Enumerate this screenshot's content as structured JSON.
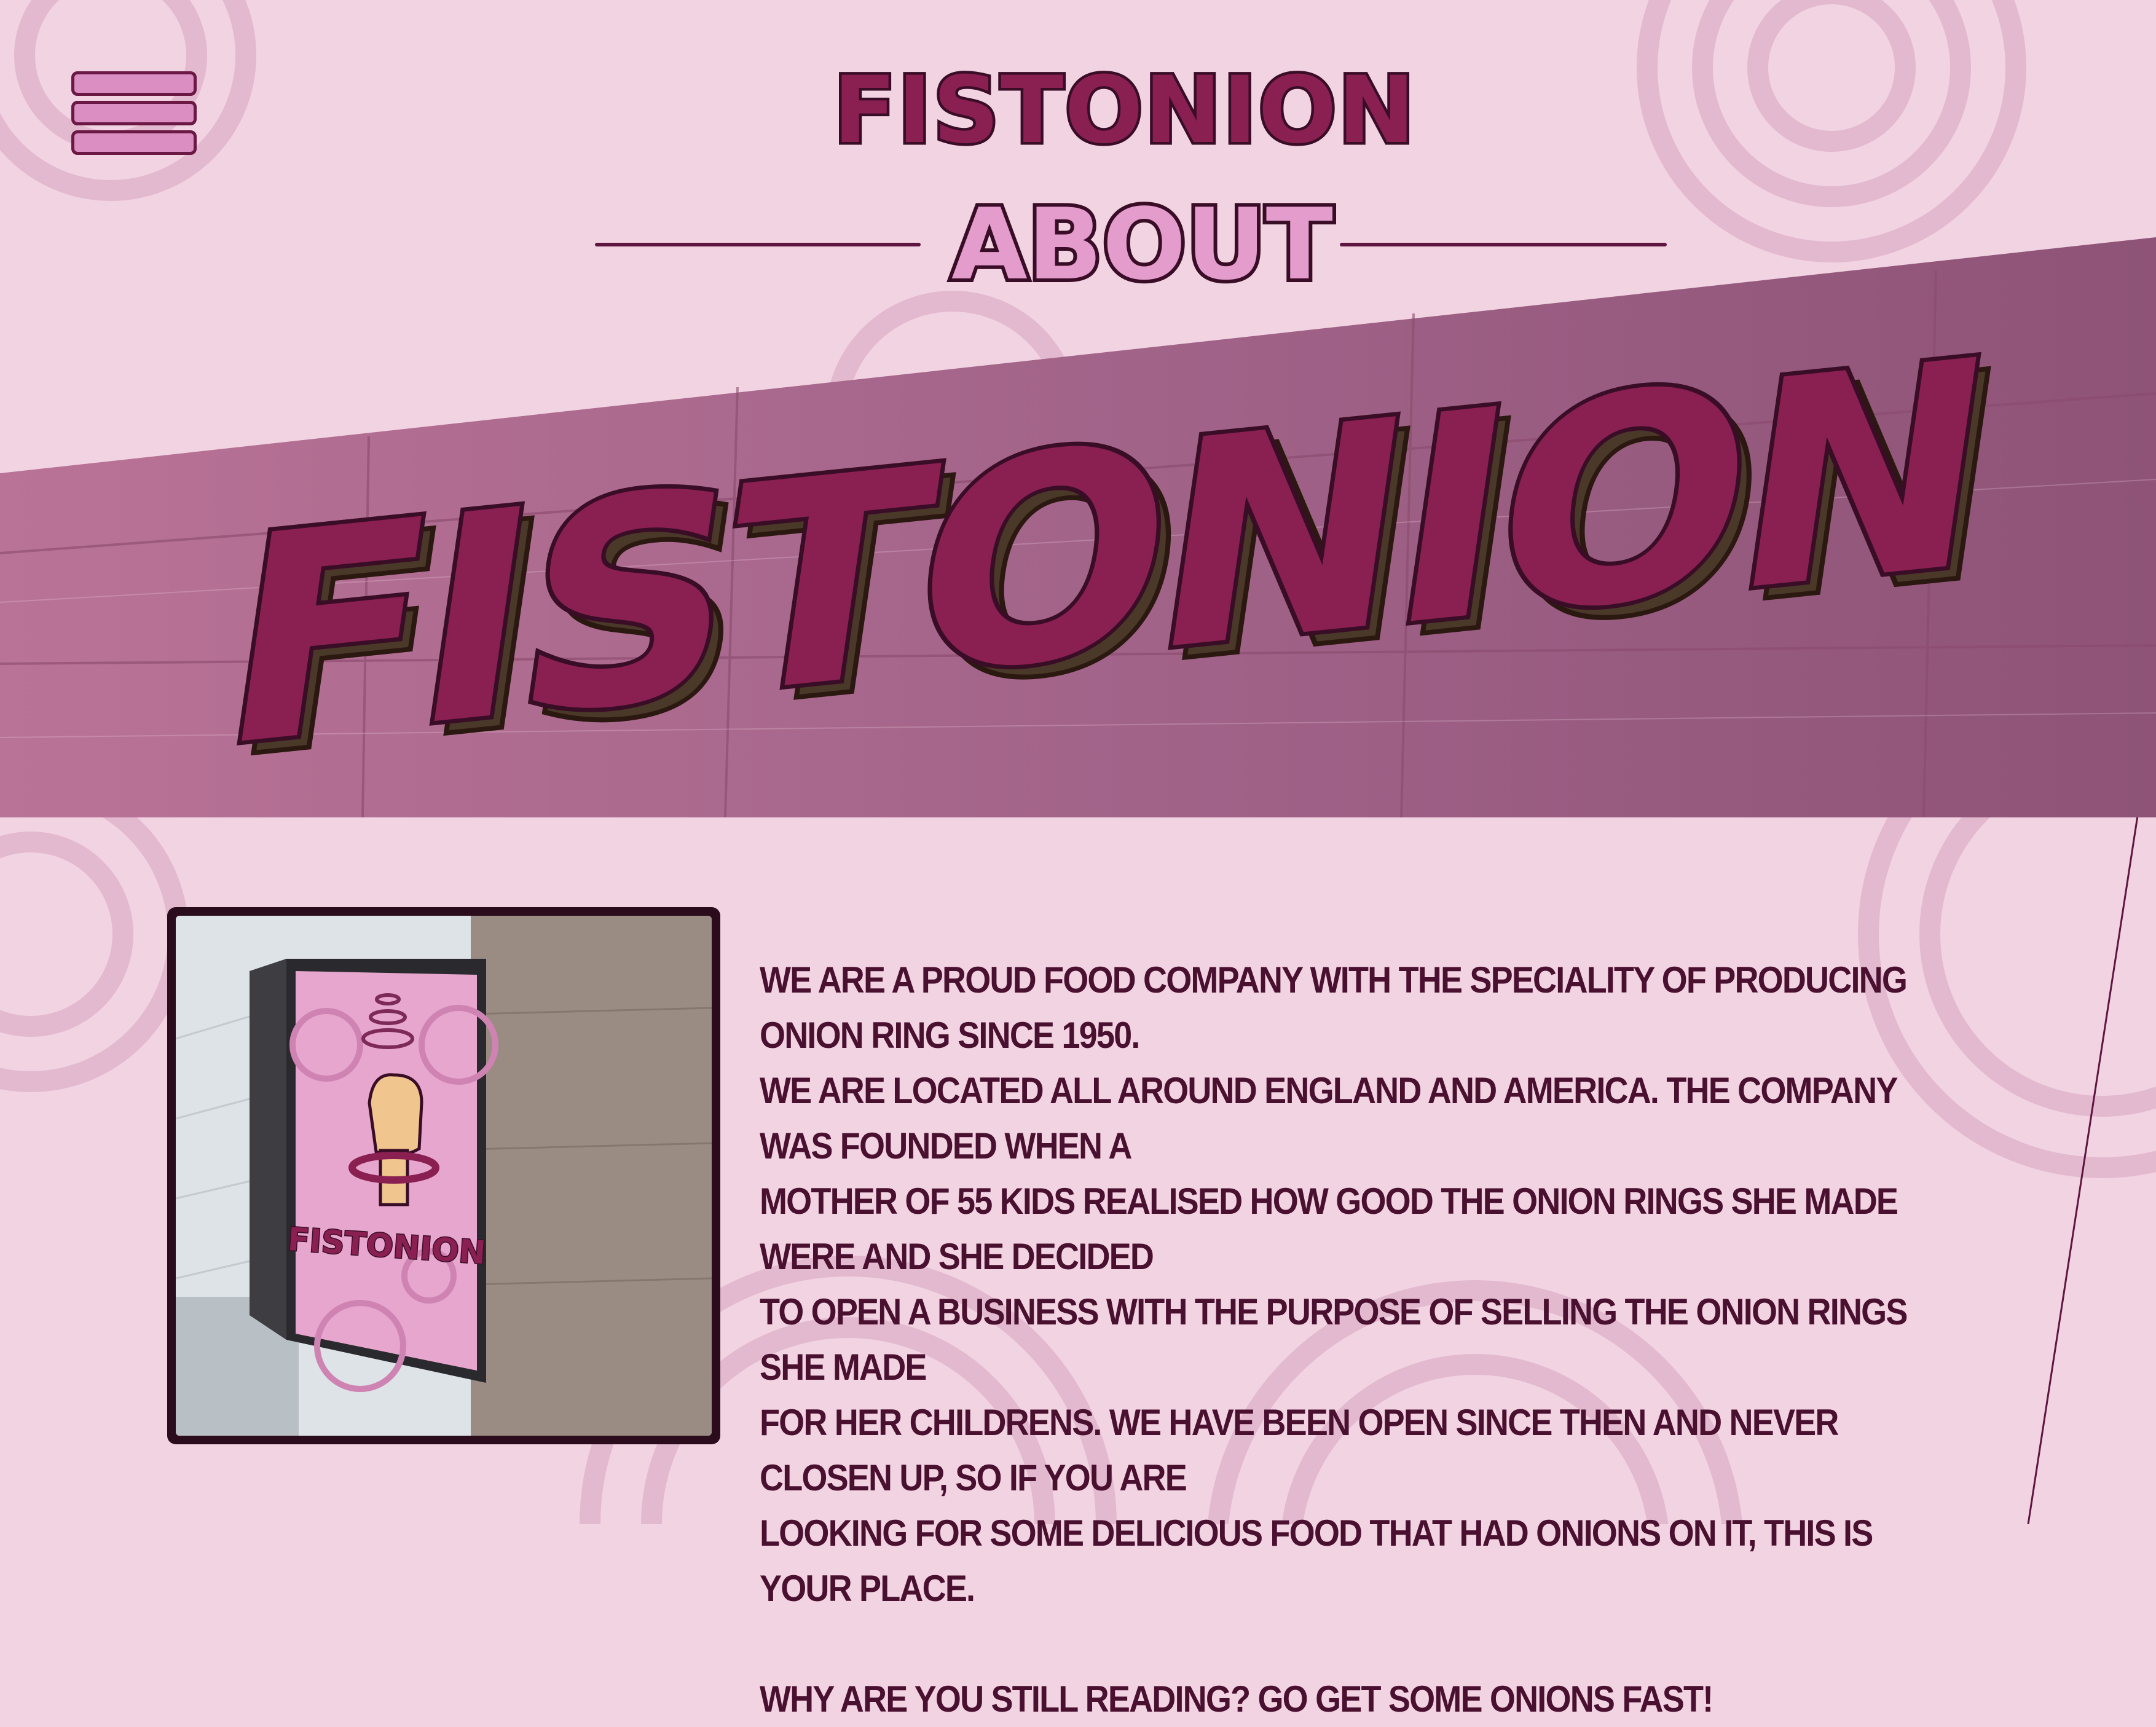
{
  "header": {
    "menu_icon": "hamburger-menu-icon",
    "brand": "FISTONION"
  },
  "title": "ABOUT",
  "banner": {
    "sign_text": "FISTONION"
  },
  "photo": {
    "sign_logo_text": "FISTONION",
    "icon": "fist-with-onion-rings"
  },
  "about": {
    "lines": [
      "We are a proud food company with the speciality of producing onion ring since 1950.",
      "We are located all around England and America. The company was founded when a",
      "mother of 55 kids realised how good the onion rings she made were and she decided",
      "to open a business with the purpose of selling the onion rings she made",
      "for her childrens. We have been open since then and never closen up, so if you are",
      "looking for some delicious food that had onions on it, this is your place."
    ],
    "closing": "Why are you still reading? Go get some onions fast!"
  },
  "colors": {
    "background": "#f2d3e2",
    "primary": "#8a1f52",
    "outline": "#3a0d27",
    "accent": "#e49ccd",
    "wall": "#9a5a7c",
    "text": "#4a1030"
  }
}
